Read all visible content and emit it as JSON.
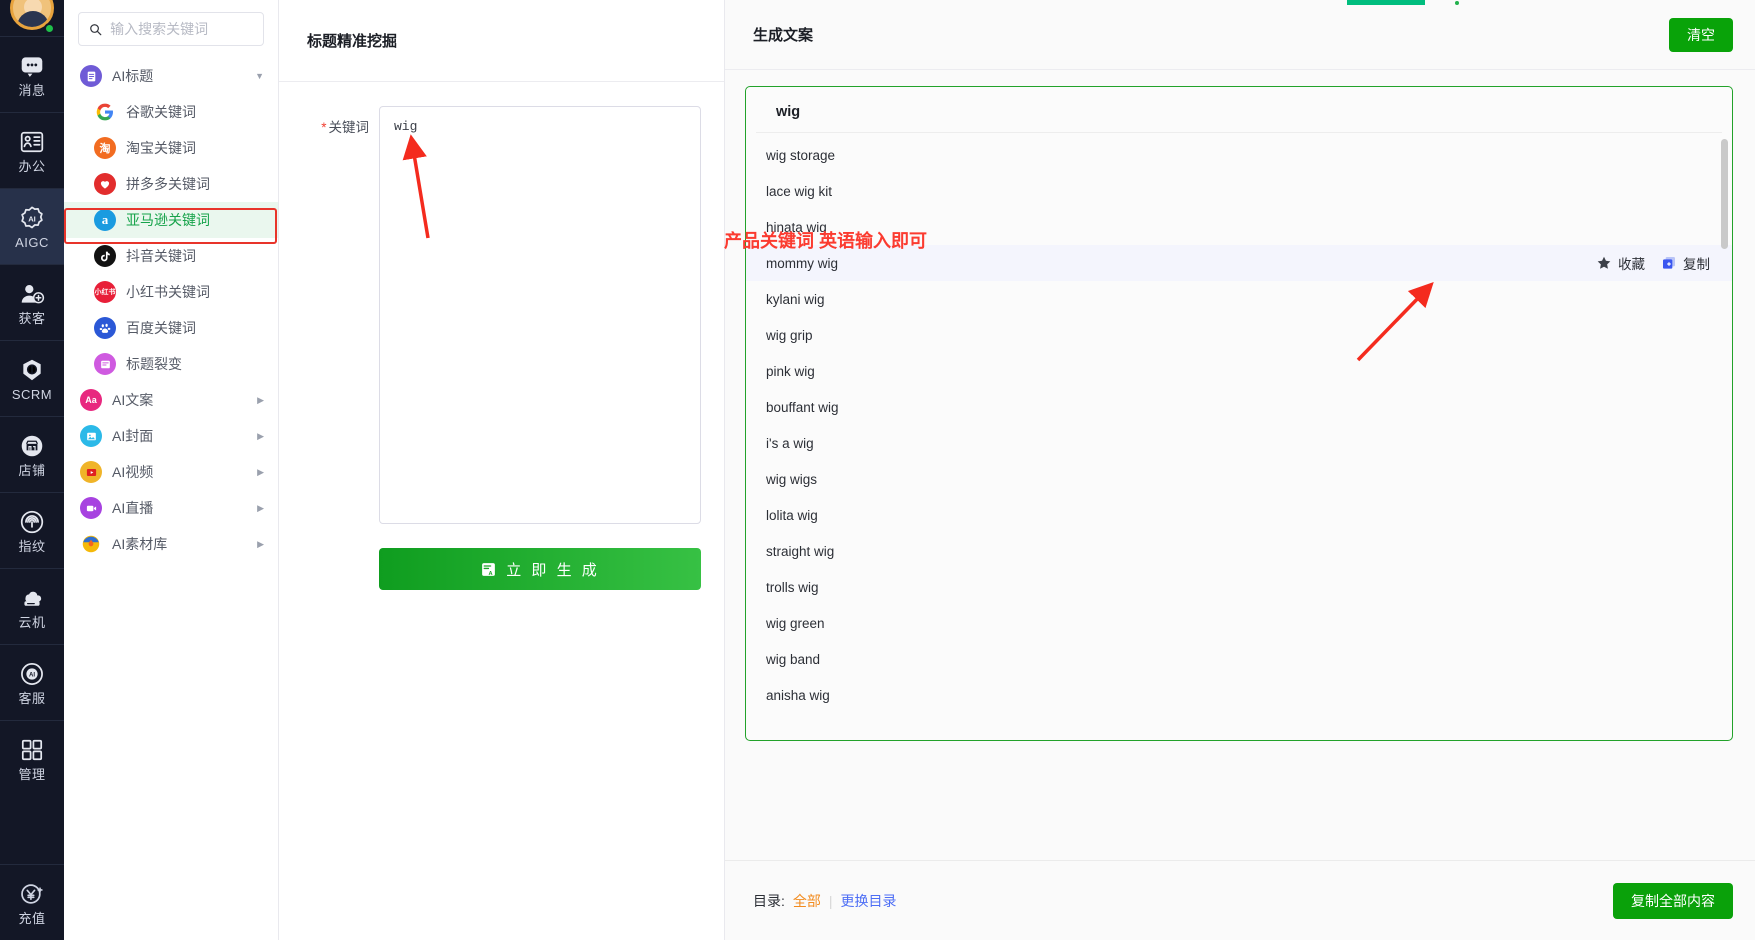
{
  "rail": {
    "avatar_name": "user-avatar",
    "items": [
      {
        "label": "消息",
        "icon": "message-icon",
        "active": false
      },
      {
        "label": "办公",
        "icon": "office-icon",
        "active": false
      },
      {
        "label": "AIGC",
        "icon": "aigc-icon",
        "active": true
      },
      {
        "label": "获客",
        "icon": "acquire-customer-icon",
        "active": false
      },
      {
        "label": "SCRM",
        "icon": "scrm-icon",
        "active": false
      },
      {
        "label": "店铺",
        "icon": "shop-icon",
        "active": false
      },
      {
        "label": "指纹",
        "icon": "fingerprint-icon",
        "active": false
      },
      {
        "label": "云机",
        "icon": "cloud-machine-icon",
        "active": false
      },
      {
        "label": "客服",
        "icon": "customer-service-icon",
        "active": false
      },
      {
        "label": "管理",
        "icon": "management-icon",
        "active": false
      }
    ],
    "bottom_item": {
      "label": "充值",
      "icon": "recharge-icon"
    }
  },
  "nav": {
    "search": {
      "placeholder": "输入搜索关键词",
      "value": ""
    },
    "groups": [
      {
        "label": "AI标题",
        "icon": "ai-title-icon",
        "color": "#6f5bd6",
        "expanded": true,
        "caret": "▼",
        "children": [
          {
            "label": "谷歌关键词",
            "icon": "google-icon"
          },
          {
            "label": "淘宝关键词",
            "icon": "taobao-icon"
          },
          {
            "label": "拼多多关键词",
            "icon": "pinduoduo-icon"
          },
          {
            "label": "亚马逊关键词",
            "icon": "amazon-icon",
            "active": true
          },
          {
            "label": "抖音关键词",
            "icon": "douyin-icon"
          },
          {
            "label": "小红书关键词",
            "icon": "xiaohongshu-icon"
          },
          {
            "label": "百度关键词",
            "icon": "baidu-icon"
          },
          {
            "label": "标题裂变",
            "icon": "title-split-icon"
          }
        ]
      },
      {
        "label": "AI文案",
        "icon": "ai-copy-icon",
        "color": "#e8287f",
        "expanded": false,
        "caret": "▶",
        "children": []
      },
      {
        "label": "AI封面",
        "icon": "ai-cover-icon",
        "color": "#2bb9e8",
        "expanded": false,
        "caret": "▶",
        "children": []
      },
      {
        "label": "AI视频",
        "icon": "ai-video-icon",
        "color": "#f0b429",
        "expanded": false,
        "caret": "▶",
        "children": []
      },
      {
        "label": "AI直播",
        "icon": "ai-live-icon",
        "color": "#a742e0",
        "expanded": false,
        "caret": "▶",
        "children": []
      },
      {
        "label": "AI素材库",
        "icon": "ai-assets-icon",
        "color": "#2f6fd0",
        "expanded": false,
        "caret": "▶",
        "children": []
      }
    ]
  },
  "center": {
    "title": "标题精准挖掘",
    "keyword_label": "关键词",
    "required_mark": "*",
    "keyword_value": "wig",
    "keyword_placeholder": "",
    "generate_label": "立 即 生 成",
    "annotation": "产品关键词 英语输入即可"
  },
  "right": {
    "title": "生成文案",
    "clear_label": "清空",
    "card_title": "wig",
    "results": [
      "wig storage",
      "lace wig kit",
      "hinata wig",
      "mommy wig",
      "kylani wig",
      "wig grip",
      "pink wig",
      "bouffant wig",
      "i's a wig",
      "wig wigs",
      "lolita wig",
      "straight wig",
      "trolls wig",
      "wig green",
      "wig band",
      "anisha wig"
    ],
    "hovered_index": 3,
    "row_actions": {
      "favorite_label": "收藏",
      "copy_label": "复制"
    },
    "footer": {
      "catalog_label": "目录:",
      "catalog_all": "全部",
      "catalog_sep": "|",
      "catalog_change": "更换目录",
      "copy_all_label": "复制全部内容"
    }
  },
  "colors": {
    "accent_green": "#09a309",
    "highlight_red": "#e8342a",
    "annotation_red": "#fb3b30",
    "link_blue": "#4d6ef5",
    "catalog_orange": "#f28b1e"
  }
}
